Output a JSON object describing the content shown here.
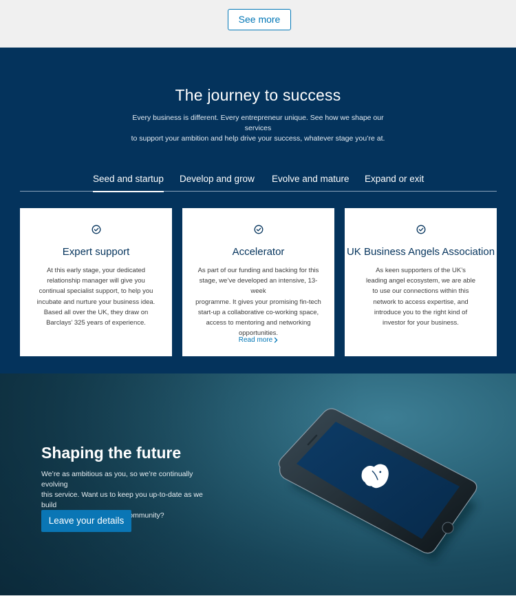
{
  "top": {
    "see_more_label": "See more"
  },
  "journey": {
    "title": "The journey to success",
    "subtitle_line1": "Every business is different. Every entrepreneur unique. See how we shape our services",
    "subtitle_line2": "to support your ambition and help drive your success, whatever stage you’re at.",
    "tabs": [
      {
        "label": "Seed and startup",
        "active": true
      },
      {
        "label": "Develop and grow",
        "active": false
      },
      {
        "label": "Evolve and mature",
        "active": false
      },
      {
        "label": "Expand or exit",
        "active": false
      }
    ],
    "cards": [
      {
        "icon": "check-circle-icon",
        "title": "Expert support",
        "lines": [
          "At this early stage, your dedicated",
          "relationship manager will give you",
          "continual specialist support, to help you",
          "incubate and nurture your business idea.",
          "Based all over the UK, they draw on",
          "Barclays’ 325 years of experience."
        ]
      },
      {
        "icon": "check-circle-icon",
        "title": "Accelerator",
        "lines": [
          "As part of our funding and backing for this",
          "stage, we’ve developed an intensive, 13-week",
          "programme. It gives your promising fin-tech",
          "start-up a collaborative co-working space,",
          "access to mentoring and networking",
          "opportunities."
        ],
        "link": "Read more"
      },
      {
        "icon": "check-circle-icon",
        "title": "UK Business Angels Association",
        "lines": [
          "As keen supporters of the UK’s",
          "leading angel ecosystem, we are able",
          "to use our connections within this",
          "network to access expertise, and",
          "introduce you to the right kind of",
          "investor for your business."
        ]
      }
    ]
  },
  "hero": {
    "title": "Shaping the future",
    "body_line1": "We’re as ambitious as you, so we’re continually evolving",
    "body_line2": "this service. Want us to keep you up-to-date as we build",
    "body_line3": "and grow this like-minded community?",
    "button_label": "Leave your details",
    "image": "smartphone-with-eagle-logo"
  },
  "colors": {
    "navy": "#04335c",
    "accent_blue": "#0076b6",
    "button_blue": "#0a76b5",
    "light_band": "#f0f0f0"
  }
}
